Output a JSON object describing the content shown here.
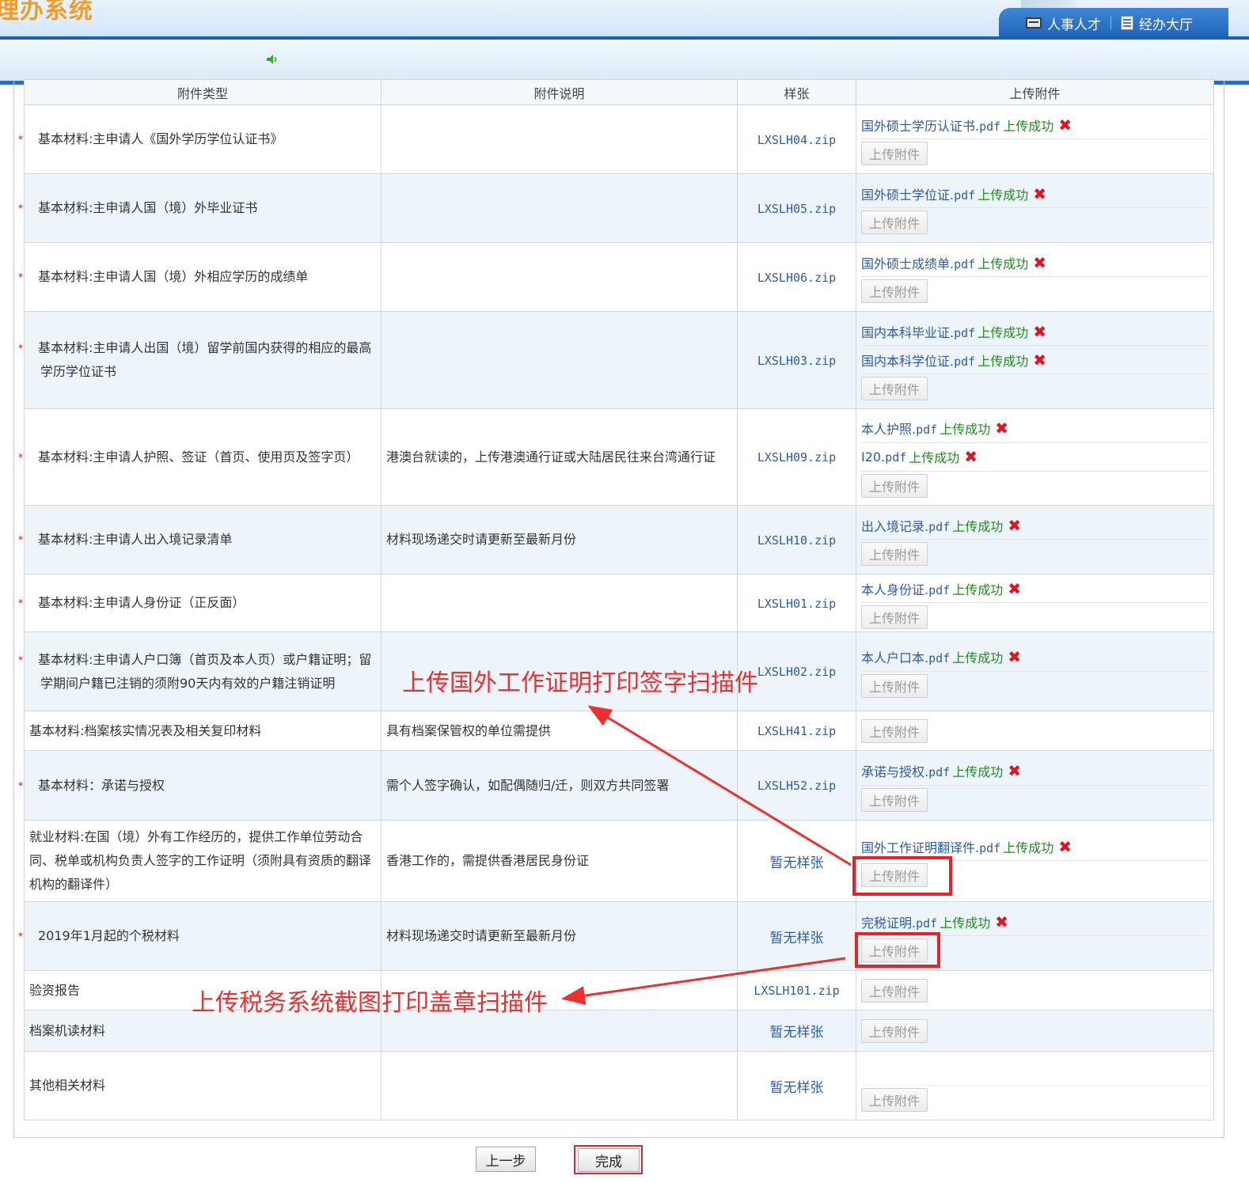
{
  "header": {
    "logo_text": "理办系统",
    "nav": [
      {
        "label": "人事人才",
        "icon": "folder-icon"
      },
      {
        "label": "经办大厅",
        "icon": "building-icon"
      }
    ]
  },
  "table": {
    "headers": [
      "附件类型",
      "附件说明",
      "样张",
      "上传附件"
    ],
    "upload_label": "上传附件",
    "success_label": "上传成功",
    "rows": [
      {
        "required": true,
        "type": "基本材料:主申请人《国外学历学位认证书》",
        "desc": "",
        "sample": "LXSLH04.zip",
        "files": [
          {
            "name": "国外硕士学历认证书.",
            "ext": "pdf"
          }
        ]
      },
      {
        "required": true,
        "type": "基本材料:主申请人国（境）外毕业证书",
        "desc": "",
        "sample": "LXSLH05.zip",
        "files": [
          {
            "name": "国外硕士学位证.",
            "ext": "pdf"
          }
        ]
      },
      {
        "required": true,
        "type": "基本材料:主申请人国（境）外相应学历的成绩单",
        "desc": "",
        "sample": "LXSLH06.zip",
        "files": [
          {
            "name": "国外硕士成绩单.",
            "ext": "pdf"
          }
        ]
      },
      {
        "required": true,
        "type": "基本材料:主申请人出国（境）留学前国内获得的相应的最高学历学位证书",
        "desc": "",
        "sample": "LXSLH03.zip",
        "files": [
          {
            "name": "国内本科毕业证.",
            "ext": "pdf"
          },
          {
            "name": "国内本科学位证.",
            "ext": "pdf"
          }
        ]
      },
      {
        "required": true,
        "type": "基本材料:主申请人护照、签证（首页、使用页及签字页）",
        "desc": "港澳台就读的，上传港澳通行证或大陆居民往来台湾通行证",
        "sample": "LXSLH09.zip",
        "files": [
          {
            "name": "本人护照.",
            "ext": "pdf"
          },
          {
            "name": "I20.",
            "ext": "pdf"
          }
        ]
      },
      {
        "required": true,
        "type": "基本材料:主申请人出入境记录清单",
        "desc": "材料现场递交时请更新至最新月份",
        "sample": "LXSLH10.zip",
        "files": [
          {
            "name": "出入境记录.",
            "ext": "pdf"
          }
        ]
      },
      {
        "required": true,
        "type": "基本材料:主申请人身份证（正反面）",
        "desc": "",
        "sample": "LXSLH01.zip",
        "files": [
          {
            "name": "本人身份证.",
            "ext": "pdf"
          }
        ]
      },
      {
        "required": true,
        "type": "基本材料:主申请人户口簿（首页及本人页）或户籍证明；留学期间户籍已注销的须附90天内有效的户籍注销证明",
        "desc": "",
        "sample": "LXSLH02.zip",
        "files": [
          {
            "name": "本人户口本.",
            "ext": "pdf"
          }
        ]
      },
      {
        "required": false,
        "type": "基本材料:档案核实情况表及相关复印材料",
        "desc": "具有档案保管权的单位需提供",
        "sample": "LXSLH41.zip",
        "files": []
      },
      {
        "required": true,
        "type": "基本材料：承诺与授权",
        "desc": "需个人签字确认，如配偶随归/迁，则双方共同签署",
        "sample": "LXSLH52.zip",
        "files": [
          {
            "name": "承诺与授权.",
            "ext": "pdf"
          }
        ]
      },
      {
        "required": false,
        "type": "就业材料:在国（境）外有工作经历的，提供工作单位劳动合同、税单或机构负责人签字的工作证明（须附具有资质的翻译机构的翻译件）",
        "desc": "香港工作的，需提供香港居民身份证",
        "sample": "暂无样张",
        "files": [
          {
            "name": "国外工作证明翻译件.",
            "ext": "pdf"
          }
        ]
      },
      {
        "required": true,
        "type": "2019年1月起的个税材料",
        "desc": "材料现场递交时请更新至最新月份",
        "sample": "暂无样张",
        "files": [
          {
            "name": "完税证明.",
            "ext": "pdf"
          }
        ]
      },
      {
        "required": false,
        "type": "验资报告",
        "desc": "",
        "sample": "LXSLH101.zip",
        "files": []
      },
      {
        "required": false,
        "type": "档案机读材料",
        "desc": "",
        "sample": "暂无样张",
        "files": []
      },
      {
        "required": false,
        "type": "其他相关材料",
        "desc": "",
        "sample": "暂无样张",
        "files": []
      }
    ]
  },
  "buttons": {
    "prev": "上一步",
    "done": "完成"
  },
  "annotations": {
    "work_proof": "上传国外工作证明打印签字扫描件",
    "tax_proof": "上传税务系统截图打印盖章扫描件",
    "color": "#ee2f2f"
  }
}
